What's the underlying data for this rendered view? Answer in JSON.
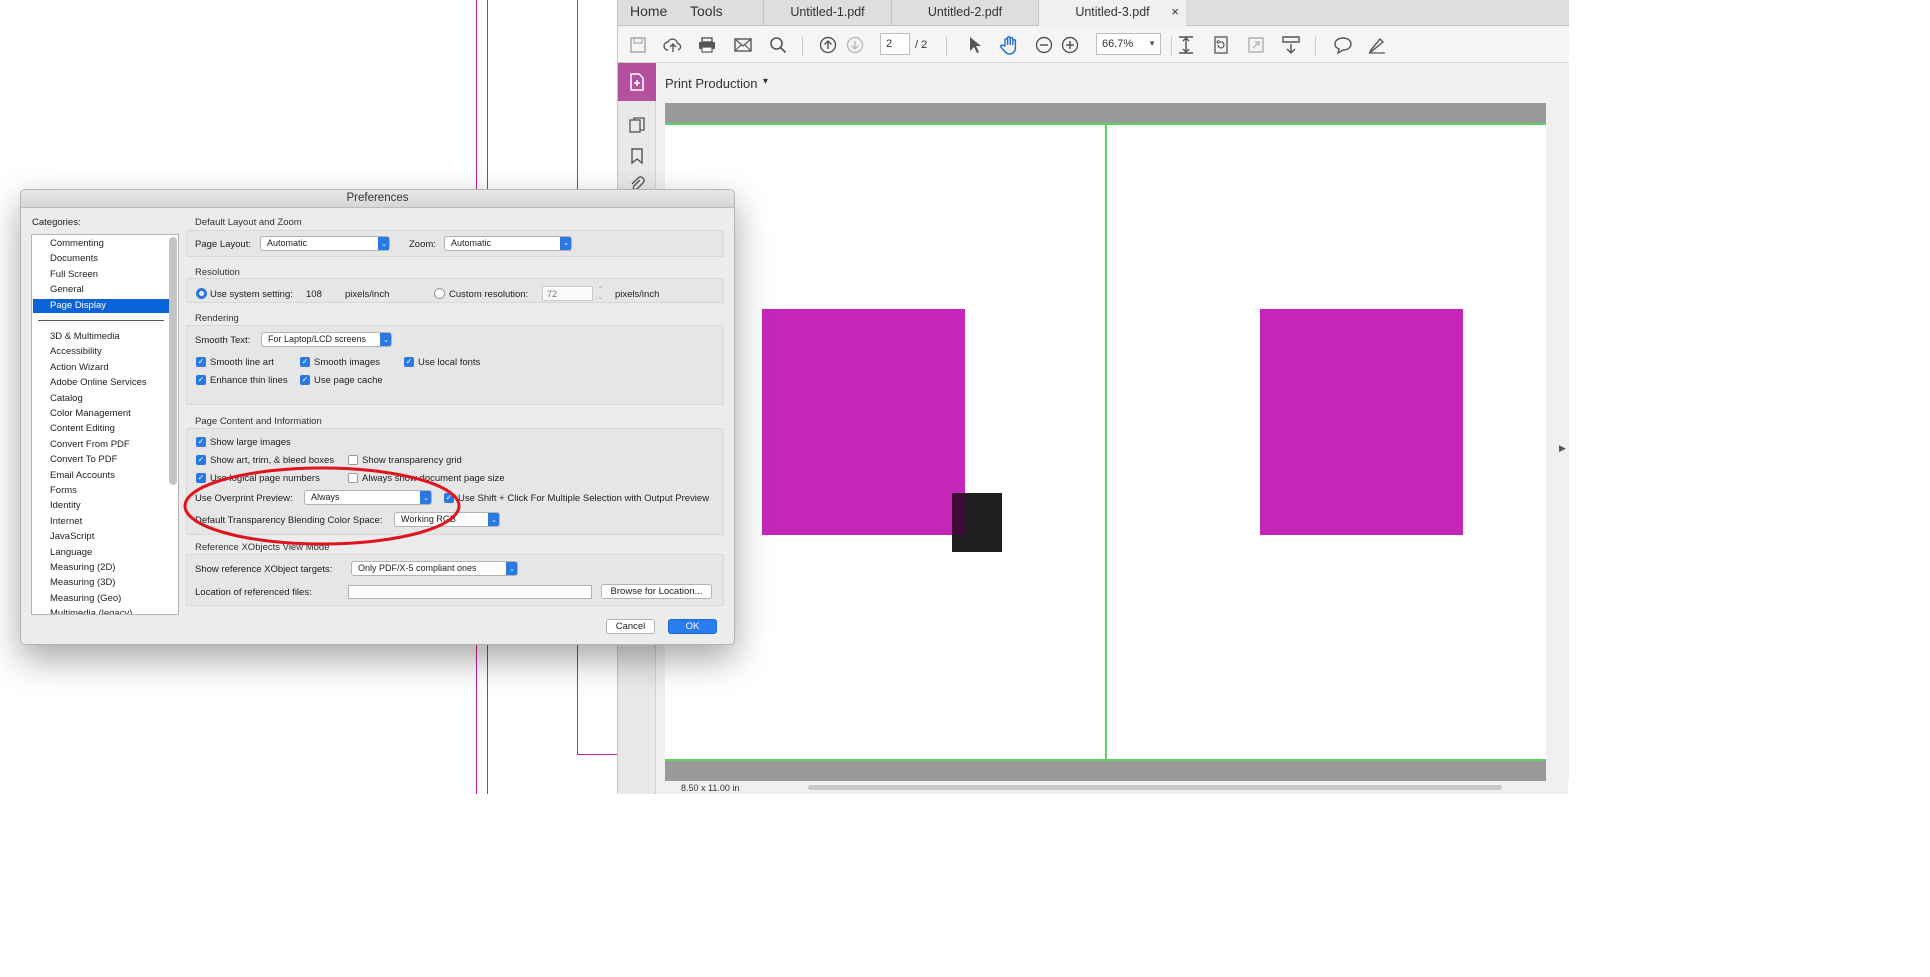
{
  "acrobat": {
    "nav": {
      "home": "Home",
      "tools": "Tools"
    },
    "tabs": [
      {
        "label": "Untitled-1.pdf"
      },
      {
        "label": "Untitled-2.pdf"
      },
      {
        "label": "Untitled-3.pdf",
        "active": true
      }
    ],
    "tab_close": "×",
    "toolbar": {
      "page_current": "2",
      "page_total": "/ 2",
      "zoom": "66.7%",
      "icons": [
        "save-icon",
        "upload-icon",
        "print-icon",
        "email-icon",
        "search-icon",
        "page-up-icon",
        "page-down-icon",
        "select-icon",
        "hand-icon",
        "zoom-out-icon",
        "zoom-in-icon",
        "fit-page-icon",
        "rotate-icon",
        "fullscreen-icon",
        "scroll-mode-icon",
        "comment-icon",
        "sign-icon"
      ]
    },
    "tool_header": {
      "label": "Print Production",
      "dropdown_glyph": "▾"
    },
    "status": {
      "page_size": "8.50 x 11.00 in"
    },
    "colors": {
      "accent": "#b4509e",
      "square": "#c427b8",
      "trim_line": "#5fd35f"
    }
  },
  "dialog": {
    "title": "Preferences",
    "categories_label": "Categories:",
    "categories_top": [
      "Commenting",
      "Documents",
      "Full Screen",
      "General",
      "Page Display"
    ],
    "selected_category": "Page Display",
    "categories": [
      "3D & Multimedia",
      "Accessibility",
      "Action Wizard",
      "Adobe Online Services",
      "Catalog",
      "Color Management",
      "Content Editing",
      "Convert From PDF",
      "Convert To PDF",
      "Email Accounts",
      "Forms",
      "Identity",
      "Internet",
      "JavaScript",
      "Language",
      "Measuring (2D)",
      "Measuring (3D)",
      "Measuring (Geo)",
      "Multimedia (legacy)"
    ],
    "layout_zoom": {
      "section": "Default Layout and Zoom",
      "page_layout_label": "Page Layout:",
      "page_layout_value": "Automatic",
      "zoom_label": "Zoom:",
      "zoom_value": "Automatic"
    },
    "resolution": {
      "section": "Resolution",
      "system_label": "Use system setting:",
      "system_value": "108",
      "units1": "pixels/inch",
      "custom_label": "Custom resolution:",
      "custom_placeholder": "72",
      "units2": "pixels/inch",
      "selected": "system"
    },
    "rendering": {
      "section": "Rendering",
      "smooth_text_label": "Smooth Text:",
      "smooth_text_value": "For Laptop/LCD screens",
      "smooth_line_art": "Smooth line art",
      "smooth_images": "Smooth images",
      "use_local_fonts": "Use local fonts",
      "enhance_thin_lines": "Enhance thin lines",
      "use_page_cache": "Use page cache"
    },
    "page_content": {
      "section": "Page Content and Information",
      "show_large_images": "Show large images",
      "show_boxes": "Show art, trim, & bleed boxes",
      "show_transparency_grid": "Show transparency grid",
      "logical_page_numbers": "Use logical page numbers",
      "always_show_page_size": "Always show document page size",
      "overprint_label": "Use Overprint Preview:",
      "overprint_value": "Always",
      "shift_click": "Use Shift + Click For Multiple Selection with Output Preview",
      "blend_label": "Default Transparency Blending Color Space:",
      "blend_value": "Working RGB"
    },
    "xobjects": {
      "section": "Reference XObjects View Mode",
      "targets_label": "Show reference XObject targets:",
      "targets_value": "Only PDF/X-5 compliant ones",
      "location_label": "Location of referenced files:",
      "location_value": "",
      "browse": "Browse for Location..."
    },
    "buttons": {
      "cancel": "Cancel",
      "ok": "OK"
    },
    "check_glyph": "✓",
    "select_glyph": "⌃⌄"
  }
}
